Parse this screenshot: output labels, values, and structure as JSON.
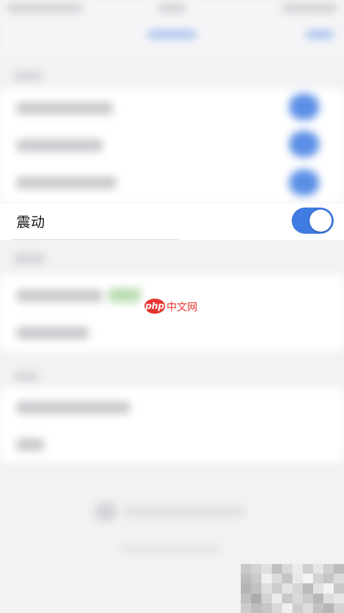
{
  "vibration": {
    "label": "震动",
    "enabled": true,
    "accent": "#3f7be0"
  },
  "watermark": {
    "logo_text": "php",
    "text": "中文网",
    "color": "#e8352d"
  }
}
